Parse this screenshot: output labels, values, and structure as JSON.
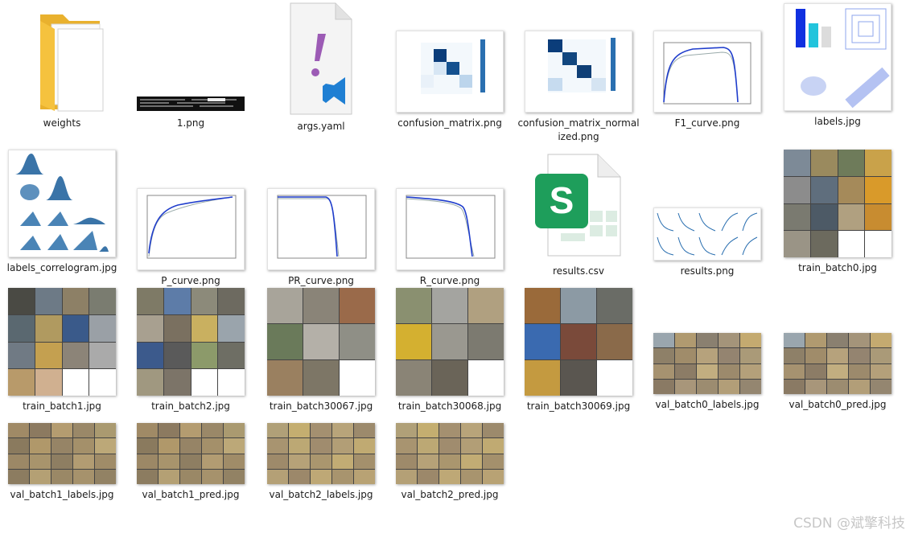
{
  "files": [
    {
      "name": "weights",
      "kind": "folder"
    },
    {
      "name": "1.png",
      "kind": "terminal"
    },
    {
      "name": "args.yaml",
      "kind": "yaml"
    },
    {
      "name": "confusion_matrix.png",
      "kind": "confusion"
    },
    {
      "name": "confusion_matrix_normalized.png",
      "kind": "confusion"
    },
    {
      "name": "F1_curve.png",
      "kind": "curve"
    },
    {
      "name": "labels.jpg",
      "kind": "labels"
    },
    {
      "name": "labels_correlogram.jpg",
      "kind": "correlogram"
    },
    {
      "name": "P_curve.png",
      "kind": "curve"
    },
    {
      "name": "PR_curve.png",
      "kind": "curve"
    },
    {
      "name": "R_curve.png",
      "kind": "curve"
    },
    {
      "name": "results.csv",
      "kind": "csv"
    },
    {
      "name": "results.png",
      "kind": "results"
    },
    {
      "name": "train_batch0.jpg",
      "kind": "batch"
    },
    {
      "name": "train_batch1.jpg",
      "kind": "batch"
    },
    {
      "name": "train_batch2.jpg",
      "kind": "batch"
    },
    {
      "name": "train_batch30067.jpg",
      "kind": "batch"
    },
    {
      "name": "train_batch30068.jpg",
      "kind": "batch"
    },
    {
      "name": "train_batch30069.jpg",
      "kind": "batch"
    },
    {
      "name": "val_batch0_labels.jpg",
      "kind": "val"
    },
    {
      "name": "val_batch0_pred.jpg",
      "kind": "val"
    },
    {
      "name": "val_batch1_labels.jpg",
      "kind": "val"
    },
    {
      "name": "val_batch1_pred.jpg",
      "kind": "val"
    },
    {
      "name": "val_batch2_labels.jpg",
      "kind": "val"
    },
    {
      "name": "val_batch2_pred.jpg",
      "kind": "val"
    }
  ],
  "watermark": "CSDN @斌擎科技",
  "colors": {
    "folder": "#f5c23e",
    "vscode": "#1f7fd3",
    "yaml_mark": "#9c5bb5",
    "sheets": "#1e9e5b",
    "plot_line": "#1f3dcc"
  }
}
